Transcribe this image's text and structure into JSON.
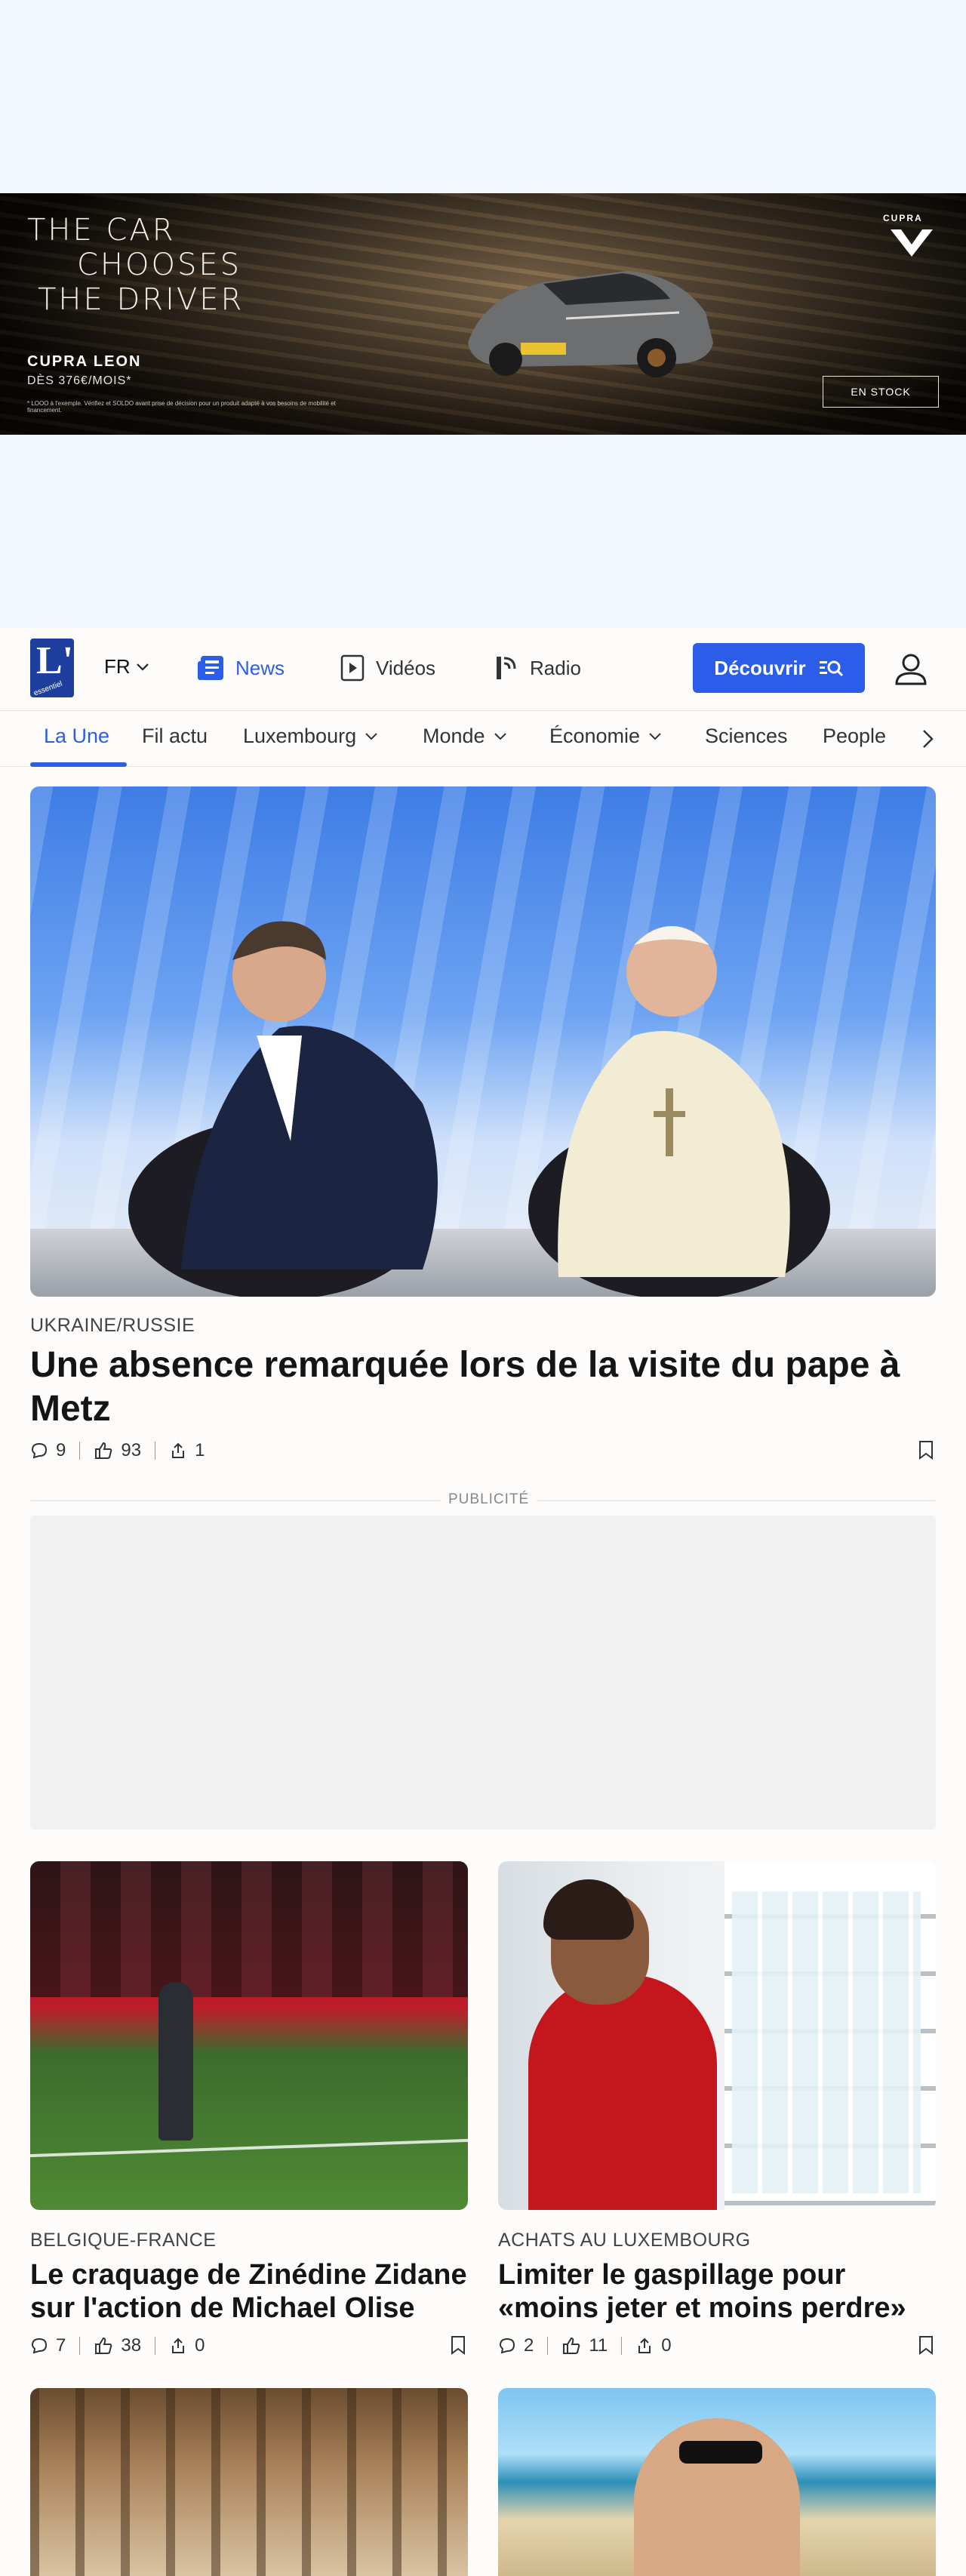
{
  "ad": {
    "headline": [
      "THE CAR",
      "CHOOSES",
      "THE DRIVER"
    ],
    "model": "CUPRA LEON",
    "price": "DÈS 376€/MOIS*",
    "legal": "* LOOO à l'exemple. Vérifiez et SOLDO avant prise de décision pour un produit adapté à vos besoins de mobilité et financement.",
    "brand": "CUPRA",
    "cta": "EN STOCK"
  },
  "header": {
    "logo_letter": "L'",
    "logo_sub": "essentiel",
    "lang": "FR",
    "nav": [
      {
        "label": "News",
        "icon": "news-icon",
        "active": true
      },
      {
        "label": "Vidéos",
        "icon": "play-icon",
        "active": false
      },
      {
        "label": "Radio",
        "icon": "radio-icon",
        "active": false
      }
    ],
    "discover_label": "Découvrir"
  },
  "sections": [
    {
      "label": "La Une",
      "active": true,
      "dropdown": false
    },
    {
      "label": "Fil actu",
      "active": false,
      "dropdown": false
    },
    {
      "label": "Luxembourg",
      "active": false,
      "dropdown": true
    },
    {
      "label": "Monde",
      "active": false,
      "dropdown": true
    },
    {
      "label": "Économie",
      "active": false,
      "dropdown": true
    },
    {
      "label": "Sciences",
      "active": false,
      "dropdown": false
    },
    {
      "label": "People",
      "active": false,
      "dropdown": false
    }
  ],
  "hero": {
    "kicker": "UKRAINE/RUSSIE",
    "title": "Une absence remarquée lors de la visite du pape à Metz",
    "comments": "9",
    "likes": "93",
    "shares": "1"
  },
  "pub_label": "PUBLICITÉ",
  "cards": [
    {
      "kicker": "BELGIQUE-FRANCE",
      "title": "Le craquage de Zinédine Zidane sur l'action de Michael Olise",
      "comments": "7",
      "likes": "38",
      "shares": "0"
    },
    {
      "kicker": "ACHATS AU LUXEMBOURG",
      "title": "Limiter le gaspillage pour «moins jeter et moins perdre»",
      "comments": "2",
      "likes": "11",
      "shares": "0"
    }
  ],
  "colors": {
    "accent": "#2b5de8",
    "logo": "#1f3f9e",
    "ad_bg": "#f2f6ff"
  }
}
